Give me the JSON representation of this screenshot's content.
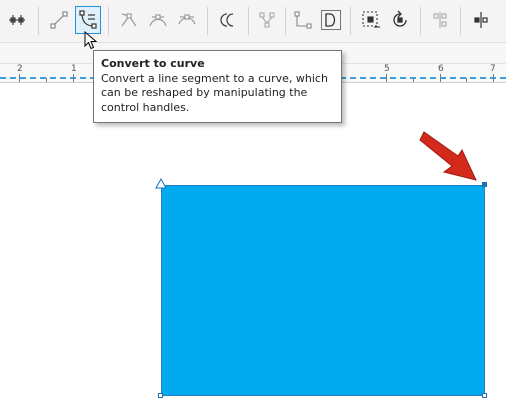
{
  "toolbar": {
    "active_tool": "Convert to curve"
  },
  "ruler": {
    "numbers": [
      "2",
      "1",
      "5",
      "6",
      "7"
    ]
  },
  "tooltip": {
    "title": "Convert to curve",
    "description": "Convert a line segment to a curve, which can be reshaped by manipulating the control handles."
  },
  "colors": {
    "shape_fill": "#00aaee",
    "annotation_arrow": "#d42a1c",
    "accent": "#2a8fd6"
  }
}
